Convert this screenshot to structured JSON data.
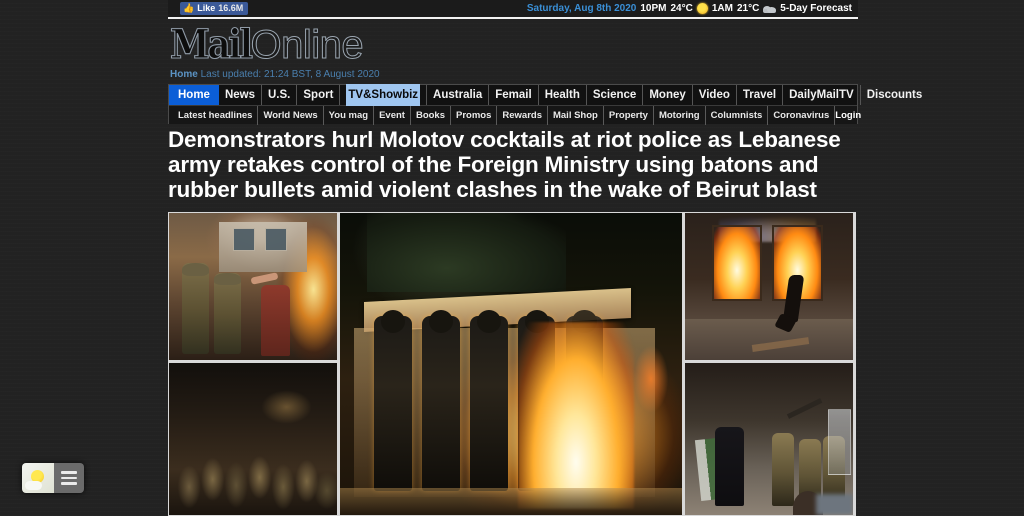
{
  "topbar": {
    "facebook": {
      "label": "Like",
      "count": "16.6M",
      "icon": "thumbs-up-icon"
    },
    "weather": {
      "date": "Saturday, Aug 8th 2020",
      "now_time": "10PM",
      "now_temp": "24°C",
      "now_icon": "sun-icon",
      "later_time": "1AM",
      "later_temp": "21°C",
      "later_icon": "cloud-icon",
      "forecast_link": "5-Day Forecast"
    }
  },
  "masthead": {
    "logo_mail": "Mail",
    "logo_online": "Online",
    "section": "Home",
    "last_updated": "Last updated: 21:24 BST, 8 August 2020"
  },
  "nav": {
    "main": [
      {
        "label": "Home",
        "state": "active"
      },
      {
        "label": "News",
        "state": "normal"
      },
      {
        "label": "U.S.",
        "state": "normal"
      },
      {
        "label": "Sport",
        "state": "normal"
      },
      {
        "label": "TV&Showbiz",
        "state": "selected"
      },
      {
        "label": "Australia",
        "state": "normal"
      },
      {
        "label": "Femail",
        "state": "normal"
      },
      {
        "label": "Health",
        "state": "normal"
      },
      {
        "label": "Science",
        "state": "normal"
      },
      {
        "label": "Money",
        "state": "normal"
      },
      {
        "label": "Video",
        "state": "normal"
      },
      {
        "label": "Travel",
        "state": "normal"
      },
      {
        "label": "DailyMailTV",
        "state": "normal"
      },
      {
        "label": "Discounts",
        "state": "normal"
      }
    ],
    "sub": [
      "Latest headlines",
      "World News",
      "You mag",
      "Event",
      "Books",
      "Promos",
      "Rewards",
      "Mail Shop",
      "Property",
      "Motoring",
      "Columnists",
      "Coronavirus"
    ],
    "login": "Login"
  },
  "article": {
    "headline": "Demonstrators hurl Molotov cocktails at riot police as Lebanese army retakes control of the Foreign Ministry using batons and rubber bullets amid violent clashes in the wake of Beirut blast"
  },
  "collage": {
    "photos": [
      {
        "id": "photo-soldiers-civilian",
        "caption": "Soldiers confront a civilian in front of a burning building"
      },
      {
        "id": "photo-riot-police-line",
        "caption": "Dark scene of massed riot police advancing"
      },
      {
        "id": "photo-flames-police-line",
        "caption": "Riot police line engulfed by flames at a barricade"
      },
      {
        "id": "photo-burning-facade",
        "caption": "Man runs past a building facade in flames"
      },
      {
        "id": "photo-street-clash",
        "caption": "Protester clashes with soldiers holding shields and batons"
      }
    ]
  },
  "widget": {
    "weather_icon": "sun-cloud-icon",
    "menu_icon": "hamburger-menu-icon"
  },
  "colors": {
    "accent_blue": "#0b5ed7",
    "selection_blue": "#9fc6f0",
    "facebook_blue": "#3b5998",
    "date_blue": "#3a8fd6",
    "page_bg": "#222222"
  }
}
